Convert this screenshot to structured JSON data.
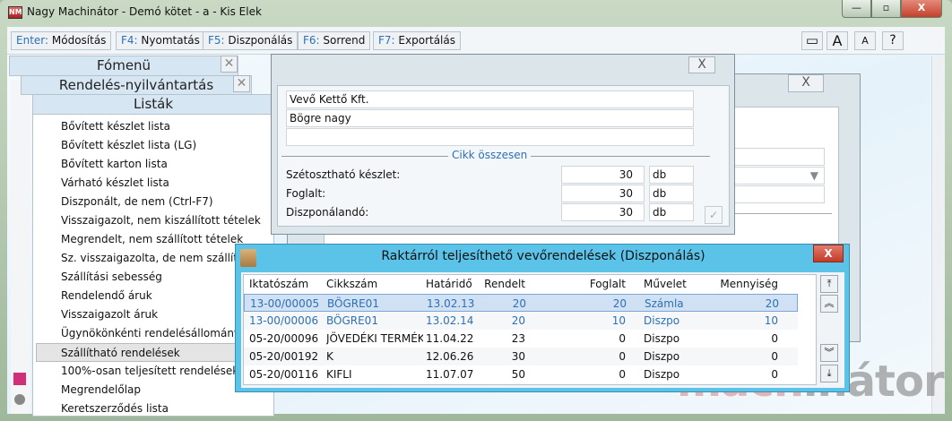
{
  "window": {
    "title": "Nagy Machinátor - Demó kötet - a - Kis Elek",
    "minimize": "—",
    "maximize": "▫",
    "close": "X"
  },
  "toolbar": {
    "buttons": [
      {
        "key": "Enter:",
        "label": "Módosítás"
      },
      {
        "key": "F4:",
        "label": "Nyomtatás"
      },
      {
        "key": "F5:",
        "label": "Diszponálás"
      },
      {
        "key": "F6:",
        "label": "Sorrend"
      },
      {
        "key": "F7:",
        "label": "Exportálás"
      }
    ],
    "right": {
      "window": "▭",
      "font_large": "A",
      "font_small": "A",
      "help": "?"
    }
  },
  "menus": {
    "main": "Fómenü",
    "orders": "Rendelés-nyilvántartás",
    "lists": "Listák",
    "close": "✕",
    "items": [
      "Bővített készlet lista",
      "Bővített készlet lista (LG)",
      "Bővített karton lista",
      "Várható készlet lista",
      "Diszponált, de nem (Ctrl-F7)",
      "Visszaigazolt, nem kiszállított tételek",
      "Megrendelt, nem szállított tételek",
      "Sz. visszaigazolta, de nem szállított",
      "Szállítási sebesség",
      "Rendelendő áruk",
      "Visszaigazolt áruk",
      "Ügynökönkénti rendelésállomány",
      "Szállítható rendelések",
      "100%-osan teljesített rendelések",
      "Megrendelőlap",
      "Keretszerződés lista"
    ],
    "selected_index": 12
  },
  "item_dialog": {
    "close": "X",
    "customer": "Vevő Kettő Kft.",
    "product": "Bögre nagy",
    "extra": "",
    "section": "Cikk összesen",
    "rows": [
      {
        "label": "Szétosztható készlet:",
        "value": "30",
        "unit": "db"
      },
      {
        "label": "Foglalt:",
        "value": "30",
        "unit": "db"
      },
      {
        "label": "Diszponálandó:",
        "value": "30",
        "unit": "db"
      }
    ],
    "ok": "✓"
  },
  "back_window": {
    "close": "X"
  },
  "orders_dialog": {
    "title": "Raktárról teljesíthető vevőrendelések (Diszponálás)",
    "close": "X",
    "columns": [
      "Iktatószám",
      "Cikkszám",
      "Határidő",
      "Rendelt",
      "Foglalt",
      "Művelet",
      "Mennyiség"
    ],
    "rows": [
      [
        "13-00/00005",
        "BÖGRE01",
        "13.02.13",
        "20",
        "20",
        "Számla",
        "20"
      ],
      [
        "13-00/00006",
        "BÖGRE01",
        "13.02.14",
        "20",
        "10",
        "Diszpo",
        "10"
      ],
      [
        "05-20/00096",
        "JÖVEDÉKI TERMÉK",
        "11.04.22",
        "23",
        "0",
        "Diszpo",
        "0"
      ],
      [
        "05-20/00192",
        "K",
        "12.06.26",
        "30",
        "0",
        "Diszpo",
        "0"
      ],
      [
        "05-20/00116",
        "KIFLI",
        "11.07.07",
        "50",
        "0",
        "Diszpo",
        "0"
      ]
    ],
    "scroll": {
      "top": "⤒",
      "page_up": "︽",
      "page_down": "︾",
      "bottom": "⤓"
    }
  },
  "watermark": "machinátor"
}
